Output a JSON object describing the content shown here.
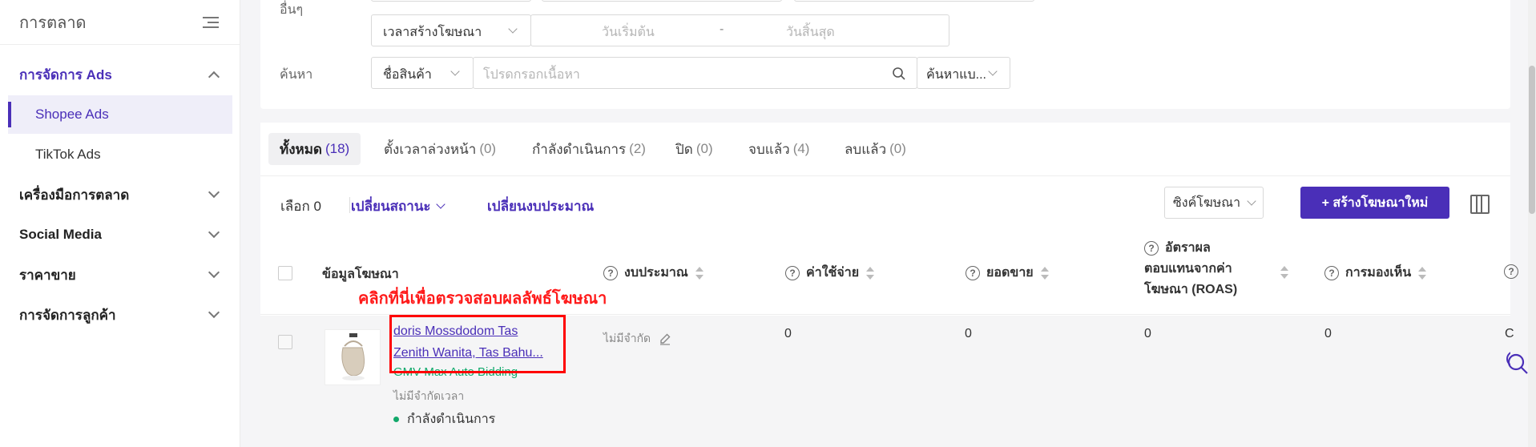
{
  "sidebar": {
    "title": "การตลาด",
    "groups": [
      {
        "label": "การจัดการ Ads"
      },
      {
        "label": "เครื่องมือการตลาด"
      },
      {
        "label": "Social Media"
      },
      {
        "label": "ราคาขาย"
      },
      {
        "label": "การจัดการลูกค้า"
      }
    ],
    "sub_items": [
      {
        "label": "Shopee Ads"
      },
      {
        "label": "TikTok Ads"
      }
    ]
  },
  "filters": {
    "other_label": "อื่นๆ",
    "time_type": "เวลาสร้างโฆษณา",
    "start_date_placeholder": "วันเริ่มต้น",
    "date_separator": "-",
    "end_date_placeholder": "วันสิ้นสุด",
    "search_label": "ค้นหา",
    "search_field": "ชื่อสินค้า",
    "search_placeholder": "โปรดกรอกเนื้อหา",
    "search_mode": "ค้นหาแบ..."
  },
  "tabs": [
    {
      "label": "ทั้งหมด",
      "count": "(18)"
    },
    {
      "label": "ตั้งเวลาล่วงหน้า",
      "count": "(0)"
    },
    {
      "label": "กำลังดำเนินการ",
      "count": "(2)"
    },
    {
      "label": "ปิด",
      "count": "(0)"
    },
    {
      "label": "จบแล้ว",
      "count": "(4)"
    },
    {
      "label": "ลบแล้ว",
      "count": "(0)"
    }
  ],
  "toolbar": {
    "selected_label": "เลือก 0",
    "change_status": "เปลี่ยนสถานะ",
    "change_budget": "เปลี่ยนงบประมาณ",
    "sync_ads": "ซิงค์โฆษณา",
    "create_ad": "+ สร้างโฆษณาใหม่"
  },
  "table": {
    "headers": {
      "ad_info": "ข้อมูลโฆษณา",
      "budget": "งบประมาณ",
      "cost": "ค่าใช้จ่าย",
      "sales": "ยอดขาย",
      "roas_1": "อัตราผล",
      "roas_2": "ตอบแทนจากค่า",
      "roas_3": "โฆษณา (ROAS)",
      "impressions": "การมองเห็น"
    },
    "row": {
      "name_line1": "doris Mossdodom Tas",
      "name_line2": "Zenith Wanita, Tas Bahu...",
      "bidding": "GMV Max Auto Bidding",
      "duration": "ไม่มีจำกัดเวลา",
      "status": "กำลังดำเนินการ",
      "budget": "ไม่มีจำกัด",
      "cost": "0",
      "sales": "0",
      "roas": "0",
      "impressions": "0",
      "next": "C"
    }
  },
  "annotation": {
    "text": "คลิกที่นี่เพื่อตรวจสอบผลลัพธ์โฆษณา"
  },
  "colors": {
    "accent": "#4a2fb8",
    "annotation": "#ff0000",
    "running": "#12a86a"
  }
}
